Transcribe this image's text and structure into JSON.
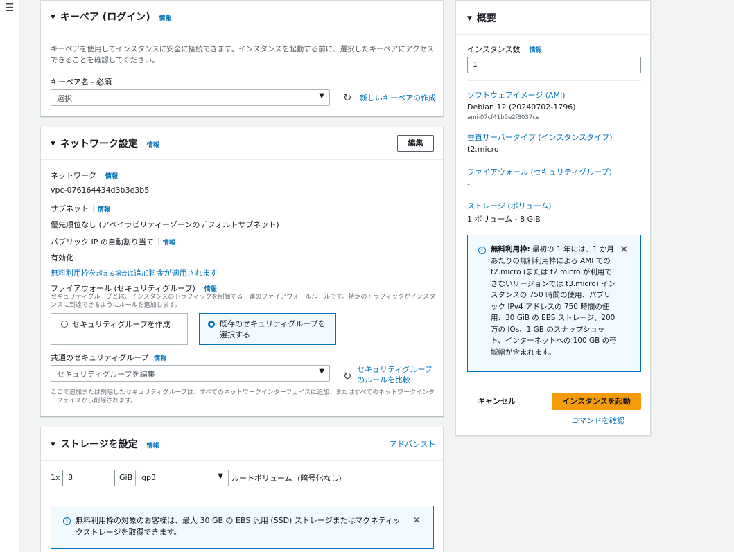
{
  "nav": {
    "menu_icon": "hamburger-icon"
  },
  "keypair": {
    "title": "キーペア (ログイン)",
    "info": "情報",
    "description": "キーペアを使用してインスタンスに安全に接続できます。インスタンスを起動する前に、選択したキーペアにアクセスできることを確認してください。",
    "name_label": "キーペア名 - 必須",
    "select_value": "選択",
    "create_link": "新しいキーペアの作成"
  },
  "network": {
    "title": "ネットワーク設定",
    "info": "情報",
    "edit_button": "編集",
    "network_label": "ネットワーク",
    "network_value": "vpc-076164434d3b3e3b5",
    "subnet_label": "サブネット",
    "subnet_value": "優先順位なし (アベイラビリティーゾーンのデフォルトサブネット)",
    "public_ip_label": "パブリック IP の自動割り当て",
    "public_ip_value": "有効化",
    "free_tier_prefix": "無料利用枠を",
    "free_tier_mid": "超える場合は",
    "free_tier_suffix": "追加料金が適用されます",
    "firewall_label": "ファイアウォール (セキュリティグループ)",
    "firewall_desc": "セキュリティグループとは、インスタンスのトラフィックを制御する一連のファイアウォールルールです。特定のトラフィックがインスタンスに到達できるようにルールを追加します。",
    "radio_create": "セキュリティグループを作成",
    "radio_existing": "既存のセキュリティグループを選択する",
    "common_sg_label": "共通のセキュリティグループ",
    "common_sg_placeholder": "セキュリティグループを編集",
    "compare_link": "セキュリティグループのルールを比較",
    "sg_note": "ここで追加または削除したセキュリティグループは、すべてのネットワークインターフェイスに追加、またはすべてのネットワークインターフェイスから削除されます。"
  },
  "storage": {
    "title": "ストレージを設定",
    "info": "情報",
    "advanced_link": "アドバンスト",
    "count_prefix": "1x",
    "size_value": "8",
    "unit": "GiB",
    "volume_type": "gp3",
    "root_label": "ルートボリューム",
    "encryption": "(暗号化なし)",
    "alert_text": "無料利用枠の対象のお客様は、最大 30 GB の EBS 汎用 (SSD) ストレージまたはマグネティックストレージを取得できます。"
  },
  "summary": {
    "title": "概要",
    "instance_count_label": "インスタンス数",
    "info": "情報",
    "instance_count_value": "1",
    "software_image_link": "ソフトウェアイメージ (AMI)",
    "ami_name": "Debian 12 (20240702-1796)",
    "ami_id": "ami-07cf41b5e2f8037ce",
    "instance_type_link": "垂直サーバータイプ (インスタンスタイプ)",
    "instance_type_value": "t2.micro",
    "firewall_link": "ファイアウォール (セキュリティグループ)",
    "firewall_value": "-",
    "storage_link": "ストレージ (ボリューム)",
    "storage_value": "1 ボリューム - 8 GiB",
    "free_tier_bold": "無料利用枠:",
    "free_tier_text": "最初の 1 年には、1 か月あたりの無料利用枠による AMI での t2.micro (または t2.micro が利用できないリージョンでは t3.micro) インスタンスの 750 時間の使用、パブリック IPv4 アドレスの 750 時間の使用、30 GiB の EBS ストレージ、200 万の IOs、1 GB のスナップショット、インターネットへの 100 GB の帯域幅が含まれます。",
    "cancel_button": "キャンセル",
    "launch_button": "インスタンスを起動",
    "command_link": "コマンドを確認"
  },
  "colors": {
    "accent": "#0073bb",
    "primary_button": "#ec7211",
    "alert_bg": "#f1faff"
  }
}
